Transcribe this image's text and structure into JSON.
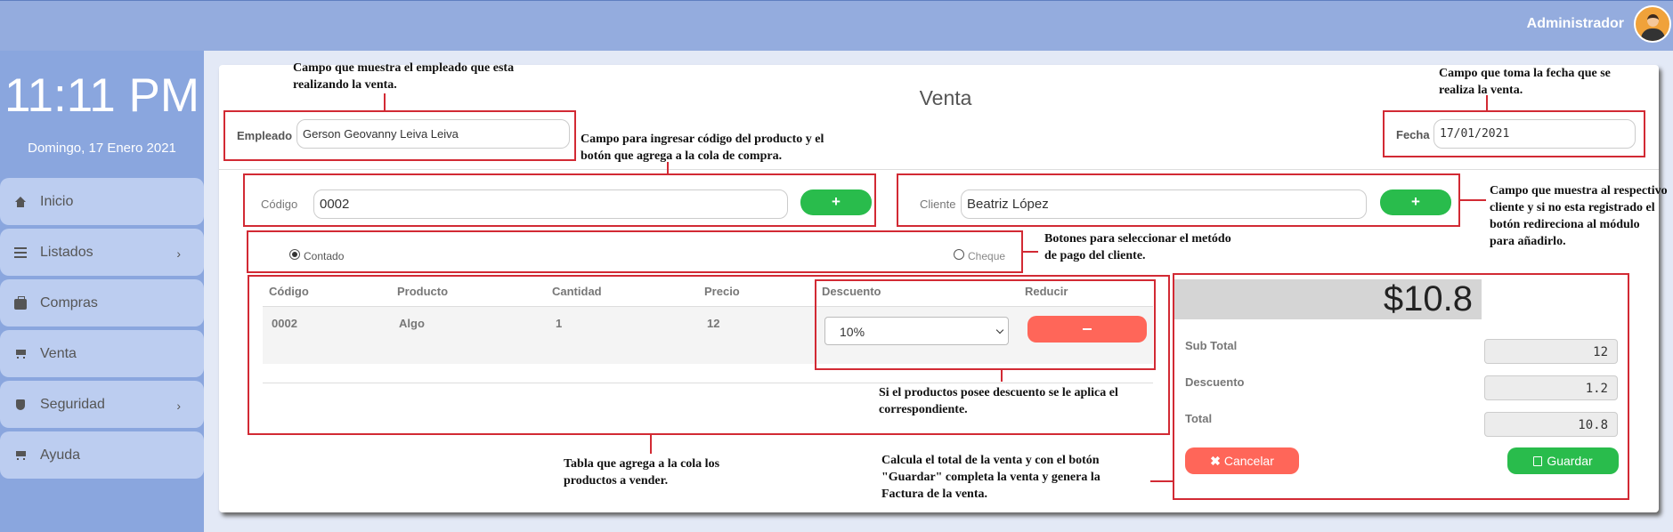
{
  "header": {
    "user_name": "Administrador"
  },
  "sidebar": {
    "time": "11:11 PM",
    "date": "Domingo, 17 Enero 2021",
    "items": [
      {
        "label": "Inicio",
        "icon": "home-icon"
      },
      {
        "label": "Listados",
        "icon": "list-icon",
        "has_submenu": true
      },
      {
        "label": "Compras",
        "icon": "briefcase-icon"
      },
      {
        "label": "Venta",
        "icon": "cart-icon"
      },
      {
        "label": "Seguridad",
        "icon": "shield-icon",
        "has_submenu": true
      },
      {
        "label": "Ayuda",
        "icon": "cart-icon"
      }
    ],
    "chevron": "›"
  },
  "form": {
    "title": "Venta",
    "employee_label": "Empleado",
    "employee_value": "Gerson Geovanny Leiva Leiva",
    "date_label": "Fecha",
    "date_value": "17/01/2021",
    "code_label": "Código",
    "code_value": "0002",
    "client_label": "Cliente",
    "client_value": "Beatriz López",
    "add_symbol": "+",
    "payment_options": [
      {
        "label": "Contado",
        "selected": true
      },
      {
        "label": "Cheque",
        "selected": false
      }
    ]
  },
  "table": {
    "headers": [
      "Código",
      "Producto",
      "Cantidad",
      "Precio",
      "Descuento",
      "Reducir"
    ],
    "rows": [
      {
        "codigo": "0002",
        "producto": "Algo",
        "cantidad": "1",
        "precio": "12",
        "descuento": "10%"
      }
    ]
  },
  "summary": {
    "total_display": "$10.8",
    "subtotal_label": "Sub Total",
    "subtotal_value": "12",
    "discount_label": "Descuento",
    "discount_value": "1.2",
    "total_label": "Total",
    "total_value": "10.8",
    "cancel_label": "Cancelar",
    "save_label": "Guardar"
  },
  "annotations": {
    "employee": "Campo que muestra el empleado que esta realizando la venta.",
    "date": "Campo que toma la fecha que se realiza la venta.",
    "code": "Campo para ingresar código del producto y el botón que agrega a la cola de compra.",
    "client": "Campo que muestra al respectivo cliente y si no esta registrado el botón redireciona al módulo para añadirlo.",
    "payment": "Botones para seleccionar el metódo de pago del cliente.",
    "discount": "Si el productos posee descuento se le aplica el correspondiente.",
    "table": "Tabla que agrega a la cola los productos a vender.",
    "totals": "Calcula el total de la venta y con el botón \"Guardar\" completa la venta y genera la Factura de la venta."
  },
  "colors": {
    "accent_green": "#29bc4c",
    "accent_red": "#ff6659",
    "annotation_red": "#d22a34",
    "sidebar": "#8aa6de",
    "topbar": "#94acde"
  }
}
